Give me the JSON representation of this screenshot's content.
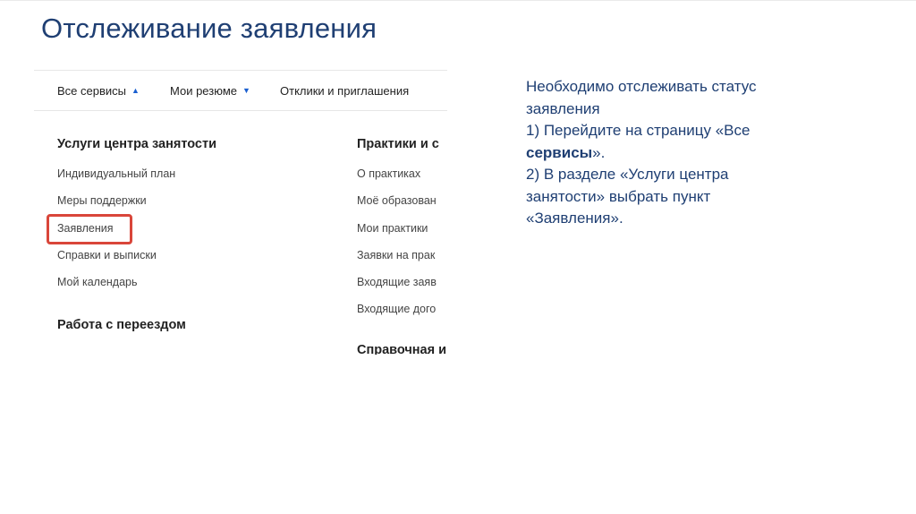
{
  "slide": {
    "title": "Отслеживание заявления"
  },
  "screenshot": {
    "topnav": [
      {
        "label": "Все сервисы",
        "caret": "▲"
      },
      {
        "label": "Мои резюме",
        "caret": "▼"
      },
      {
        "label": "Отклики и приглашения",
        "caret": ""
      }
    ],
    "left_column": {
      "heading": "Услуги центра занятости",
      "links": [
        "Индивидуальный план",
        "Меры поддержки",
        "Заявления",
        "Справки и выписки",
        "Мой календарь"
      ],
      "heading2": "Работа с переездом"
    },
    "right_column": {
      "heading": "Практики и с",
      "links": [
        "О практиках",
        "Моё образован",
        "Мои практики",
        "Заявки на прак",
        "Входящие заяв",
        "Входящие дого"
      ],
      "heading2": "Справочная и"
    },
    "highlighted_item": "Заявления"
  },
  "instructions": {
    "line1": "Необходимо отслеживать статус",
    "line2": "заявления",
    "line3": "1) Перейдите на страницу «Все",
    "line4_bold": "сервисы",
    "line4_rest": "».",
    "line5": "2) В разделе «Услуги центра",
    "line6": "занятости» выбрать пункт",
    "line7": "«Заявления»."
  },
  "colors": {
    "title": "#1f3f73",
    "highlight": "#d9463a",
    "accent": "#1a5fd0"
  }
}
